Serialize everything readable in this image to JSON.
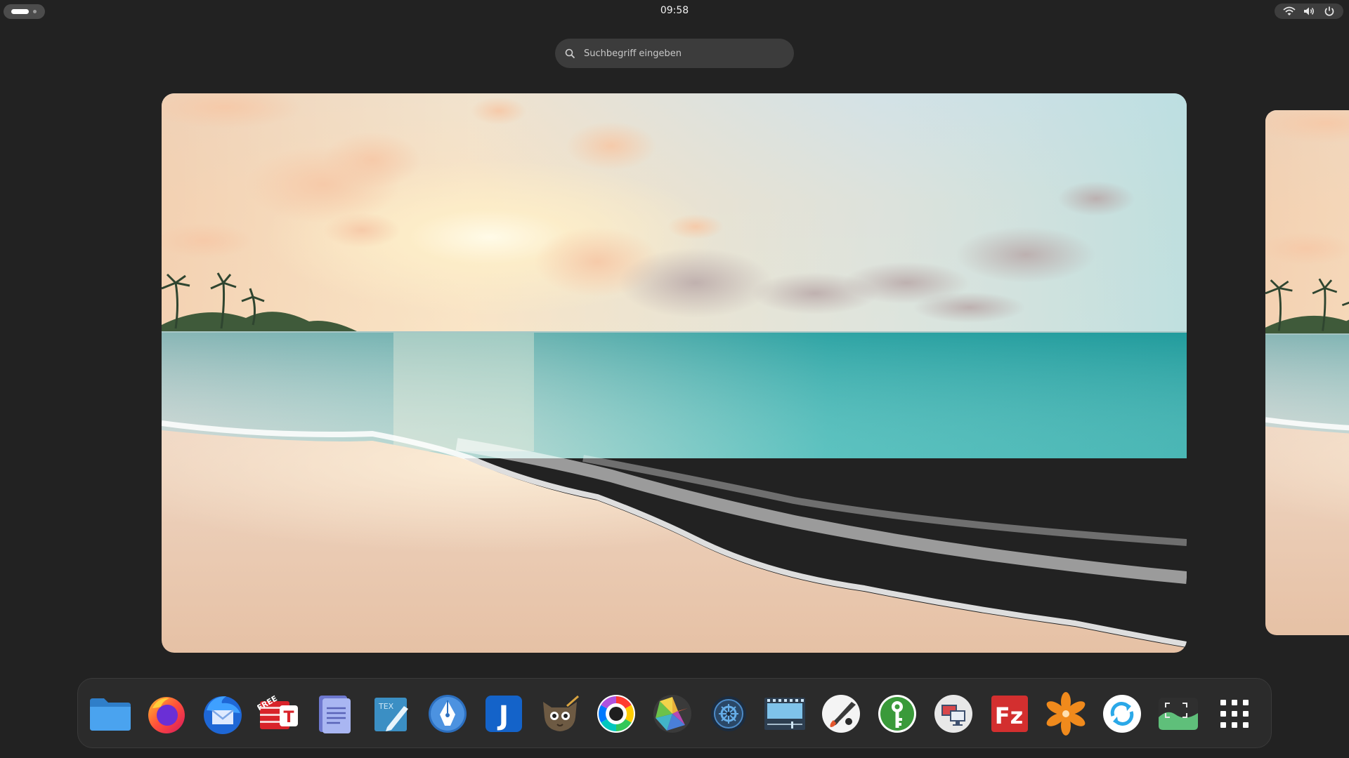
{
  "topbar": {
    "clock": "09:58",
    "icons": [
      "network-wireless-icon",
      "speaker-volume-icon",
      "power-icon"
    ]
  },
  "search": {
    "placeholder": "Suchbegriff eingeben",
    "icon": "search-icon"
  },
  "workspaces": [
    {
      "wallpaper": "beach-sunset"
    },
    {
      "wallpaper": "beach-sunset"
    }
  ],
  "dock": {
    "apps": [
      {
        "id": "files",
        "icon": "folder-icon"
      },
      {
        "id": "firefox",
        "icon": "firefox-icon"
      },
      {
        "id": "thunderbird",
        "icon": "thunderbird-icon"
      },
      {
        "id": "textmaker",
        "icon": "textmaker-free-icon",
        "badge": "FREE",
        "letter": "T"
      },
      {
        "id": "document-viewer",
        "icon": "document-icon"
      },
      {
        "id": "tex-editor",
        "icon": "tex-editor-icon",
        "badge": "TEX"
      },
      {
        "id": "inkscape",
        "icon": "pen-nib-icon"
      },
      {
        "id": "joplin",
        "icon": "joplin-icon",
        "letter": "J"
      },
      {
        "id": "gimp",
        "icon": "gimp-icon"
      },
      {
        "id": "color-picker",
        "icon": "color-wheel-icon"
      },
      {
        "id": "shotwell",
        "icon": "aperture-icon"
      },
      {
        "id": "disk-utility",
        "icon": "disk-icon"
      },
      {
        "id": "video-editor",
        "icon": "film-editor-icon"
      },
      {
        "id": "drawing",
        "icon": "paint-palette-icon"
      },
      {
        "id": "keepassxc",
        "icon": "key-icon"
      },
      {
        "id": "remote-desktop",
        "icon": "remote-desktop-icon"
      },
      {
        "id": "filezilla",
        "icon": "filezilla-icon",
        "letter": "Fz"
      },
      {
        "id": "pinwheel",
        "icon": "pinwheel-icon"
      },
      {
        "id": "sync",
        "icon": "sync-icon"
      },
      {
        "id": "screenshot",
        "icon": "screenshot-icon"
      },
      {
        "id": "show-apps",
        "icon": "app-grid-icon"
      }
    ]
  },
  "colors": {
    "background": "#222222",
    "dock": "#2b2b2b",
    "search": "#3c3c3c",
    "accent": "#ffffff"
  }
}
